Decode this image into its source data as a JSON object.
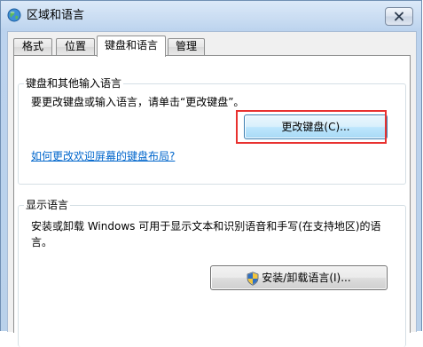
{
  "window": {
    "title": "区域和语言",
    "close_icon": "close-icon",
    "app_icon": "globe-icon"
  },
  "tabs": [
    {
      "label": "格式",
      "active": false
    },
    {
      "label": "位置",
      "active": false
    },
    {
      "label": "键盘和语言",
      "active": true
    },
    {
      "label": "管理",
      "active": false
    }
  ],
  "keyboard_group": {
    "legend": "键盘和其他输入语言",
    "description": "要更改键盘或输入语言，请单击“更改键盘”。",
    "change_keyboard_button": "更改键盘(C)...",
    "welcome_layout_link": "如何更改欢迎屏幕的键盘布局?"
  },
  "display_language_group": {
    "legend": "显示语言",
    "description_line1": "安装或卸载 Windows 可用于显示文本和识别语音和手写(在支持地区)的语",
    "description_line2": "言。",
    "install_button": "安装/卸载语言(I)...",
    "install_button_icon": "uac-shield-icon"
  },
  "colors": {
    "highlight_box": "#e8312f",
    "link": "#0066cc",
    "panel_background": "#ffffff",
    "dialog_background": "#f0f0f0"
  }
}
